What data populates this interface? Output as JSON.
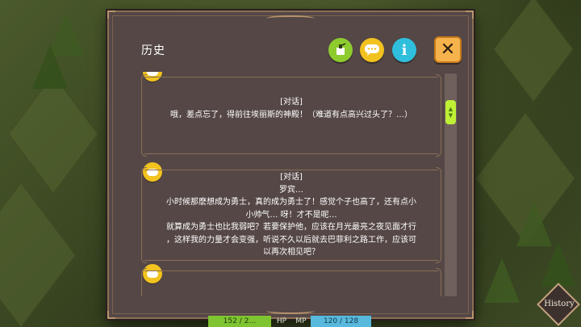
{
  "window": {
    "title": "历史"
  },
  "toolbar": {
    "auto_icon": "auto-play-icon",
    "log_icon": "speech-bubble-icon",
    "info_label": "i",
    "close_label": "✕"
  },
  "entries": [
    {
      "tag": "[对话]",
      "lines": [
        "哦，差点忘了，得前往埃丽斯的神殿！（难道有点高兴过头了？…）"
      ]
    },
    {
      "tag": "[对话]",
      "speaker": "罗宾…",
      "lines": [
        "小时候那麽想成为勇士，真的成为勇士了！感觉个子也高了，还有点小",
        "小帅气… 呀！才不是呢…",
        "就算成为勇士也比我弱吧？若要保护他，应该在月光最亮之夜见面才行",
        "，这样我的力量才会变强，听说不久以后就去巴菲利之路工作，应该可",
        "以再次相见吧？"
      ]
    }
  ],
  "hud": {
    "hp_value": "152 / 2…",
    "hp_label": "HP",
    "mp_label": "MP",
    "mp_value": "120 / 128"
  },
  "history_button": {
    "label": "History"
  },
  "colors": {
    "panel_bg": "#544746",
    "frame": "#8a6f55",
    "accent_yellow": "#f2c21f",
    "accent_green": "#8ecb2f",
    "accent_cyan": "#2fbfdc",
    "close_orange": "#f6b24b",
    "scroll_thumb": "#bff035"
  }
}
